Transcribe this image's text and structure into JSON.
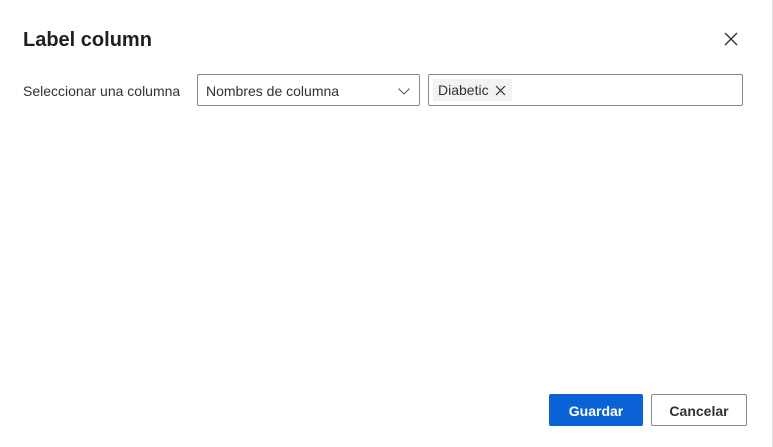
{
  "dialog": {
    "title": "Label column",
    "close_icon": "close-icon"
  },
  "selector": {
    "label": "Seleccionar una columna",
    "dropdown": {
      "selected": "Nombres de columna",
      "icon": "chevron-down-icon"
    },
    "tags": [
      {
        "label": "Diabetic",
        "remove_icon": "close-icon"
      }
    ]
  },
  "footer": {
    "save_label": "Guardar",
    "cancel_label": "Cancelar"
  },
  "colors": {
    "primary": "#0b62d6",
    "tag_bg": "#f3f2f1",
    "border": "#8a8886"
  }
}
